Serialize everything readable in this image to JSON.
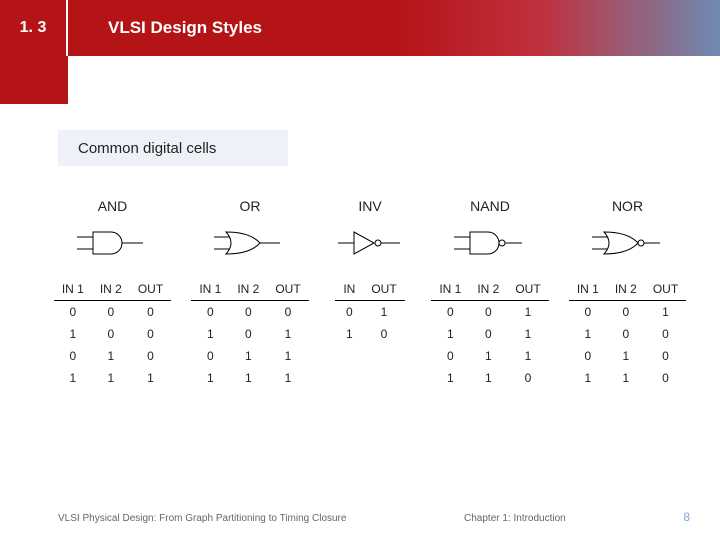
{
  "header": {
    "section_number": "1. 3",
    "title": "VLSI Design Styles"
  },
  "subheader": "Common digital cells",
  "gates": [
    {
      "name": "AND",
      "headers": [
        "IN 1",
        "IN 2",
        "OUT"
      ],
      "rows": [
        [
          0,
          0,
          0
        ],
        [
          1,
          0,
          0
        ],
        [
          0,
          1,
          0
        ],
        [
          1,
          1,
          1
        ]
      ]
    },
    {
      "name": "OR",
      "headers": [
        "IN 1",
        "IN 2",
        "OUT"
      ],
      "rows": [
        [
          0,
          0,
          0
        ],
        [
          1,
          0,
          1
        ],
        [
          0,
          1,
          1
        ],
        [
          1,
          1,
          1
        ]
      ]
    },
    {
      "name": "INV",
      "headers": [
        "IN",
        "OUT"
      ],
      "rows": [
        [
          0,
          1
        ],
        [
          1,
          0
        ]
      ]
    },
    {
      "name": "NAND",
      "headers": [
        "IN 1",
        "IN 2",
        "OUT"
      ],
      "rows": [
        [
          0,
          0,
          1
        ],
        [
          1,
          0,
          1
        ],
        [
          0,
          1,
          1
        ],
        [
          1,
          1,
          0
        ]
      ]
    },
    {
      "name": "NOR",
      "headers": [
        "IN 1",
        "IN 2",
        "OUT"
      ],
      "rows": [
        [
          0,
          0,
          1
        ],
        [
          1,
          0,
          0
        ],
        [
          0,
          1,
          0
        ],
        [
          1,
          1,
          0
        ]
      ]
    }
  ],
  "footer": {
    "left": "VLSI Physical Design: From Graph Partitioning to Timing Closure",
    "center": "Chapter 1: Introduction",
    "page": "8"
  },
  "chart_data": {
    "type": "table",
    "title": "Common digital cells truth tables",
    "tables": [
      {
        "gate": "AND",
        "columns": [
          "IN1",
          "IN2",
          "OUT"
        ],
        "rows": [
          [
            0,
            0,
            0
          ],
          [
            1,
            0,
            0
          ],
          [
            0,
            1,
            0
          ],
          [
            1,
            1,
            1
          ]
        ]
      },
      {
        "gate": "OR",
        "columns": [
          "IN1",
          "IN2",
          "OUT"
        ],
        "rows": [
          [
            0,
            0,
            0
          ],
          [
            1,
            0,
            1
          ],
          [
            0,
            1,
            1
          ],
          [
            1,
            1,
            1
          ]
        ]
      },
      {
        "gate": "INV",
        "columns": [
          "IN",
          "OUT"
        ],
        "rows": [
          [
            0,
            1
          ],
          [
            1,
            0
          ]
        ]
      },
      {
        "gate": "NAND",
        "columns": [
          "IN1",
          "IN2",
          "OUT"
        ],
        "rows": [
          [
            0,
            0,
            1
          ],
          [
            1,
            0,
            1
          ],
          [
            0,
            1,
            1
          ],
          [
            1,
            1,
            0
          ]
        ]
      },
      {
        "gate": "NOR",
        "columns": [
          "IN1",
          "IN2",
          "OUT"
        ],
        "rows": [
          [
            0,
            0,
            1
          ],
          [
            1,
            0,
            0
          ],
          [
            0,
            1,
            0
          ],
          [
            1,
            1,
            0
          ]
        ]
      }
    ]
  }
}
